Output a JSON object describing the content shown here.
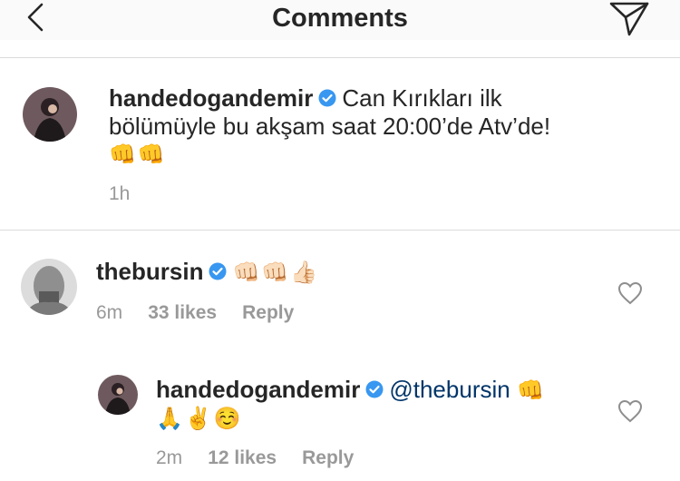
{
  "header": {
    "title": "Comments"
  },
  "caption": {
    "username": "handedogandemir",
    "text": "Can Kırıkları ilk bölümüyle bu akşam saat 20:00’de Atv’de!",
    "emoji": "👊👊",
    "time": "1h"
  },
  "comments": [
    {
      "username": "thebursin",
      "emoji": "👊🏻👊🏻👍🏻",
      "time": "6m",
      "likes": "33 likes",
      "reply_label": "Reply"
    },
    {
      "username": "handedogandemir",
      "mention": "@thebursin",
      "emoji_inline": "👊",
      "emoji_line2": "🙏✌️☺️",
      "time": "2m",
      "likes": "12 likes",
      "reply_label": "Reply"
    }
  ]
}
